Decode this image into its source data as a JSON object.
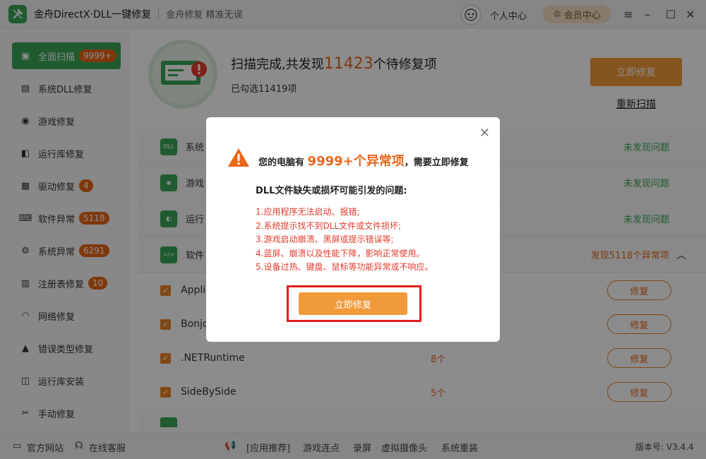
{
  "app": {
    "title": "金舟DirectX·DLL一键修复",
    "slogan": "金舟修复 精准无误",
    "user_center": "个人中心",
    "vip_center": "会员中心"
  },
  "sidebar": {
    "items": [
      {
        "label": "全面扫描",
        "badge": "9999+",
        "icon": "scan-icon",
        "active": true
      },
      {
        "label": "系统DLL修复",
        "badge": "",
        "icon": "dll-icon"
      },
      {
        "label": "游戏修复",
        "badge": "",
        "icon": "gamepad-icon"
      },
      {
        "label": "运行库修复",
        "badge": "",
        "icon": "vs-icon"
      },
      {
        "label": "驱动修复",
        "badge": "4",
        "icon": "driver-icon"
      },
      {
        "label": "软件异常",
        "badge": "5118",
        "icon": "code-icon"
      },
      {
        "label": "系统异常",
        "badge": "6291",
        "icon": "gear-icon"
      },
      {
        "label": "注册表修复",
        "badge": "10",
        "icon": "registry-icon"
      },
      {
        "label": "网络修复",
        "badge": "",
        "icon": "wifi-icon"
      },
      {
        "label": "错误类型修复",
        "badge": "",
        "icon": "warning-icon"
      },
      {
        "label": "运行库安装",
        "badge": "",
        "icon": "install-icon"
      },
      {
        "label": "手动修复",
        "badge": "",
        "icon": "tools-icon"
      }
    ]
  },
  "scan": {
    "prefix": "扫描完成,共发现",
    "count": "11423",
    "suffix": "个待修复项",
    "selected": "已勾选11419项",
    "fix_button": "立即修复",
    "rescan": "重新扫描"
  },
  "categories": [
    {
      "name": "系统",
      "status": "未发现问题",
      "icon": "DLL"
    },
    {
      "name": "游戏",
      "status": "未发现问题",
      "icon": "game"
    },
    {
      "name": "运行",
      "status": "未发现问题",
      "icon": "vs"
    },
    {
      "name": "软件",
      "status": "发现5118个异常项",
      "icon": "code"
    }
  ],
  "subitems": [
    {
      "name": "Appli",
      "count": "",
      "action": "修复"
    },
    {
      "name": "Bonjo",
      "count": "",
      "action": "修复"
    },
    {
      "name": ".NETRuntime",
      "count": "8个",
      "action": "修复"
    },
    {
      "name": "SideBySide",
      "count": "5个",
      "action": "修复"
    }
  ],
  "footer": {
    "website": "官方网站",
    "service": "在线客服",
    "recommend": "[应用推荐]",
    "links": [
      "游戏连点",
      "录屏",
      "虚拟摄像头",
      "系统重装"
    ],
    "version": "版本号: V3.4.4"
  },
  "modal": {
    "title_prefix": "您的电脑有",
    "title_count": "9999+个异常项",
    "title_suffix": "，需要立即修复",
    "subtitle": "DLL文件缺失或损坏可能引发的问题:",
    "problems": [
      "1.应用程序无法启动、报错;",
      "2.系统提示找不到DLL文件或文件损坏;",
      "3.游戏启动崩溃、黑屏或提示错误等;",
      "4.蓝屏、崩溃以及性能下降，影响正常使用。",
      "5.设备过热、键盘、鼠标等功能异常或不响应。"
    ],
    "button": "立即修复"
  },
  "colors": {
    "brand_green": "#3aa757",
    "accent_orange": "#f19a3a",
    "warning_red": "#e23b2e"
  }
}
